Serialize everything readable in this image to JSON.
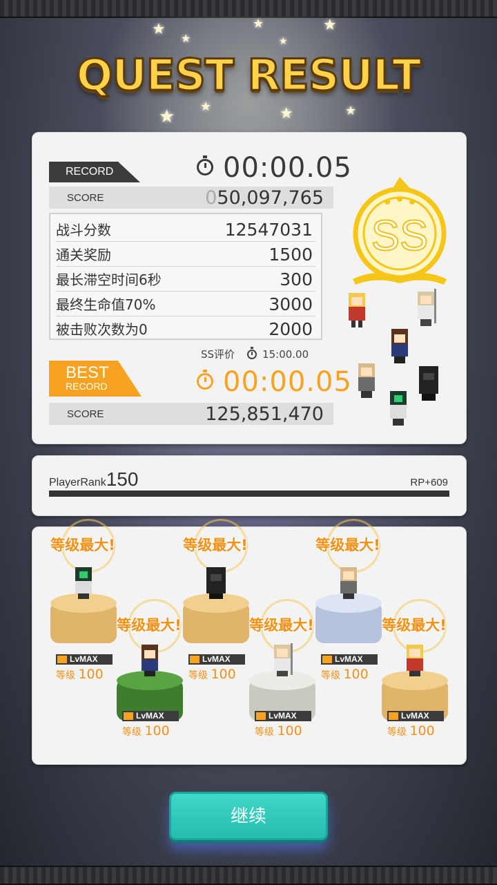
{
  "title": "QUEST RESULT",
  "result": {
    "record_tag": "RECORD",
    "record_time": "00:00.05",
    "score_label": "SCORE",
    "score_prefix": "0",
    "score_value": "50,097,765",
    "breakdown": [
      {
        "label": "战斗分数",
        "value": "12547031"
      },
      {
        "label": "通关奖励",
        "value": "1500"
      },
      {
        "label": "最长滞空时间6秒",
        "value": "300"
      },
      {
        "label": "最终生命值70%",
        "value": "3000"
      },
      {
        "label": "被击败次数为0",
        "value": "2000"
      }
    ],
    "ss_condition": "SS评价",
    "ss_time": "15:00.00",
    "best_tag_line1": "BEST",
    "best_tag_line2": "RECORD",
    "best_time": "00:00.05",
    "best_score_label": "SCORE",
    "best_score_value": "125,851,470",
    "grade": "SS"
  },
  "rank": {
    "label": "PlayerRank",
    "value": "150",
    "rp": "RP+609"
  },
  "characters": [
    {
      "max_label": "等级最大!",
      "lv_badge": "LvMAX",
      "lv_text": "等级",
      "lv_value": "100"
    },
    {
      "max_label": "等级最大!",
      "lv_badge": "LvMAX",
      "lv_text": "等级",
      "lv_value": "100"
    },
    {
      "max_label": "等级最大!",
      "lv_badge": "LvMAX",
      "lv_text": "等级",
      "lv_value": "100"
    },
    {
      "max_label": "等级最大!",
      "lv_badge": "LvMAX",
      "lv_text": "等级",
      "lv_value": "100"
    },
    {
      "max_label": "等级最大!",
      "lv_badge": "LvMAX",
      "lv_text": "等级",
      "lv_value": "100"
    },
    {
      "max_label": "等级最大!",
      "lv_badge": "LvMAX",
      "lv_text": "等级",
      "lv_value": "100"
    }
  ],
  "continue_label": "继续",
  "colors": {
    "accent": "#f7a220",
    "button": "#2fc9bb",
    "gold": "#ffd24a"
  }
}
